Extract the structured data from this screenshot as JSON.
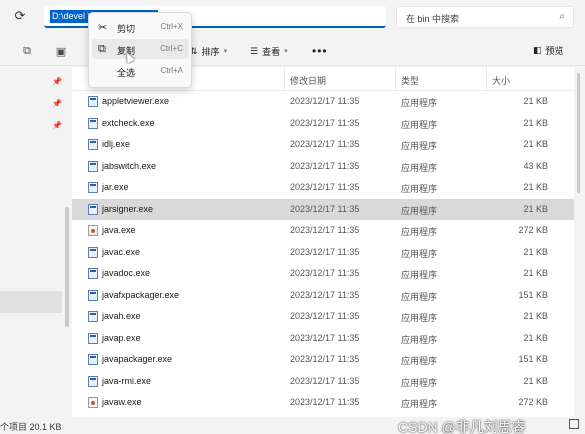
{
  "address": {
    "path": "D:\\devel...\\bin\\",
    "path_display": "D:\\devel     \\bin\\"
  },
  "search": {
    "placeholder": "在 bin 中搜索"
  },
  "toolbar": {
    "sort_label": "排序",
    "view_label": "查看",
    "more_label": "•••",
    "preview_label": "预览"
  },
  "context_menu": {
    "items": [
      {
        "label": "剪切",
        "shortcut": "Ctrl+X",
        "icon": "scissors-icon"
      },
      {
        "label": "复制",
        "shortcut": "Ctrl+C",
        "icon": "copy-icon"
      },
      {
        "label": "全选",
        "shortcut": "Ctrl+A",
        "icon": ""
      }
    ]
  },
  "columns": {
    "date": "修改日期",
    "type": "类型",
    "size": "大小"
  },
  "files": [
    {
      "name": "appletviewer.exe",
      "date": "2023/12/17 11:35",
      "type": "应用程序",
      "size": "21 KB",
      "selected": false,
      "java": false
    },
    {
      "name": "extcheck.exe",
      "date": "2023/12/17 11:35",
      "type": "应用程序",
      "size": "21 KB",
      "selected": false,
      "java": false
    },
    {
      "name": "idlj.exe",
      "date": "2023/12/17 11:35",
      "type": "应用程序",
      "size": "21 KB",
      "selected": false,
      "java": false
    },
    {
      "name": "jabswitch.exe",
      "date": "2023/12/17 11:35",
      "type": "应用程序",
      "size": "43 KB",
      "selected": false,
      "java": false
    },
    {
      "name": "jar.exe",
      "date": "2023/12/17 11:35",
      "type": "应用程序",
      "size": "21 KB",
      "selected": false,
      "java": false
    },
    {
      "name": "jarsigner.exe",
      "date": "2023/12/17 11:35",
      "type": "应用程序",
      "size": "21 KB",
      "selected": true,
      "java": false
    },
    {
      "name": "java.exe",
      "date": "2023/12/17 11:35",
      "type": "应用程序",
      "size": "272 KB",
      "selected": false,
      "java": true
    },
    {
      "name": "javac.exe",
      "date": "2023/12/17 11:35",
      "type": "应用程序",
      "size": "21 KB",
      "selected": false,
      "java": false
    },
    {
      "name": "javadoc.exe",
      "date": "2023/12/17 11:35",
      "type": "应用程序",
      "size": "21 KB",
      "selected": false,
      "java": false
    },
    {
      "name": "javafxpackager.exe",
      "date": "2023/12/17 11:35",
      "type": "应用程序",
      "size": "151 KB",
      "selected": false,
      "java": false
    },
    {
      "name": "javah.exe",
      "date": "2023/12/17 11:35",
      "type": "应用程序",
      "size": "21 KB",
      "selected": false,
      "java": false
    },
    {
      "name": "javap.exe",
      "date": "2023/12/17 11:35",
      "type": "应用程序",
      "size": "21 KB",
      "selected": false,
      "java": false
    },
    {
      "name": "javapackager.exe",
      "date": "2023/12/17 11:35",
      "type": "应用程序",
      "size": "151 KB",
      "selected": false,
      "java": false
    },
    {
      "name": "java-rmi.exe",
      "date": "2023/12/17 11:35",
      "type": "应用程序",
      "size": "21 KB",
      "selected": false,
      "java": false
    },
    {
      "name": "javaw.exe",
      "date": "2023/12/17 11:35",
      "type": "应用程序",
      "size": "272 KB",
      "selected": false,
      "java": true
    }
  ],
  "status": {
    "left": "个项目  20.1 KB",
    "watermark": "CSDN @非凡刘思睿"
  },
  "colors": {
    "accent": "#005fb8",
    "selection": "#0064c8",
    "row_selected": "#d9d9d9"
  }
}
